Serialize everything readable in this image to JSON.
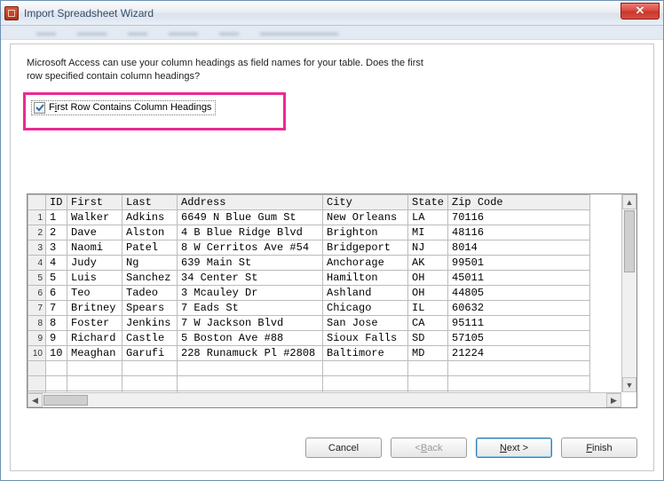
{
  "window": {
    "title": "Import Spreadsheet Wizard"
  },
  "instructions": {
    "line1": "Microsoft Access can use your column headings as field names for your table. Does the first",
    "line2": "row specified contain column headings?"
  },
  "checkbox": {
    "label_pre": "F",
    "label_hot": "i",
    "label_post": "rst Row Contains Column Headings",
    "checked": true
  },
  "columns": [
    "ID",
    "First",
    "Last",
    "Address",
    "City",
    "State",
    "Zip Code"
  ],
  "rows": [
    {
      "n": "1",
      "ID": "1",
      "First": "Walker",
      "Last": "Adkins",
      "Address": "6649 N Blue Gum St",
      "City": "New Orleans",
      "State": "LA",
      "Zip": "70116"
    },
    {
      "n": "2",
      "ID": "2",
      "First": "Dave",
      "Last": "Alston",
      "Address": "4 B Blue Ridge Blvd",
      "City": "Brighton",
      "State": "MI",
      "Zip": "48116"
    },
    {
      "n": "3",
      "ID": "3",
      "First": "Naomi",
      "Last": "Patel",
      "Address": "8 W Cerritos Ave #54",
      "City": "Bridgeport",
      "State": "NJ",
      "Zip": "8014"
    },
    {
      "n": "4",
      "ID": "4",
      "First": "Judy",
      "Last": "Ng",
      "Address": "639 Main St",
      "City": "Anchorage",
      "State": "AK",
      "Zip": "99501"
    },
    {
      "n": "5",
      "ID": "5",
      "First": "Luis",
      "Last": "Sanchez",
      "Address": "34 Center St",
      "City": "Hamilton",
      "State": "OH",
      "Zip": "45011"
    },
    {
      "n": "6",
      "ID": "6",
      "First": "Teo",
      "Last": "Tadeo",
      "Address": "3 Mcauley Dr",
      "City": "Ashland",
      "State": "OH",
      "Zip": "44805"
    },
    {
      "n": "7",
      "ID": "7",
      "First": "Britney",
      "Last": "Spears",
      "Address": "7 Eads St",
      "City": "Chicago",
      "State": "IL",
      "Zip": "60632"
    },
    {
      "n": "8",
      "ID": "8",
      "First": "Foster",
      "Last": "Jenkins",
      "Address": "7 W Jackson Blvd",
      "City": "San Jose",
      "State": "CA",
      "Zip": "95111"
    },
    {
      "n": "9",
      "ID": "9",
      "First": "Richard",
      "Last": "Castle",
      "Address": "5 Boston Ave #88",
      "City": "Sioux Falls",
      "State": "SD",
      "Zip": "57105"
    },
    {
      "n": "10",
      "ID": "10",
      "First": "Meaghan",
      "Last": "Garufi",
      "Address": "228 Runamuck Pl #2808",
      "City": "Baltimore",
      "State": "MD",
      "Zip": "21224"
    }
  ],
  "empty_rows": 3,
  "buttons": {
    "cancel": "Cancel",
    "back_lt": "< ",
    "back_hot": "B",
    "back_post": "ack",
    "next_hot": "N",
    "next_post": "ext >",
    "finish_hot": "F",
    "finish_post": "inish"
  }
}
